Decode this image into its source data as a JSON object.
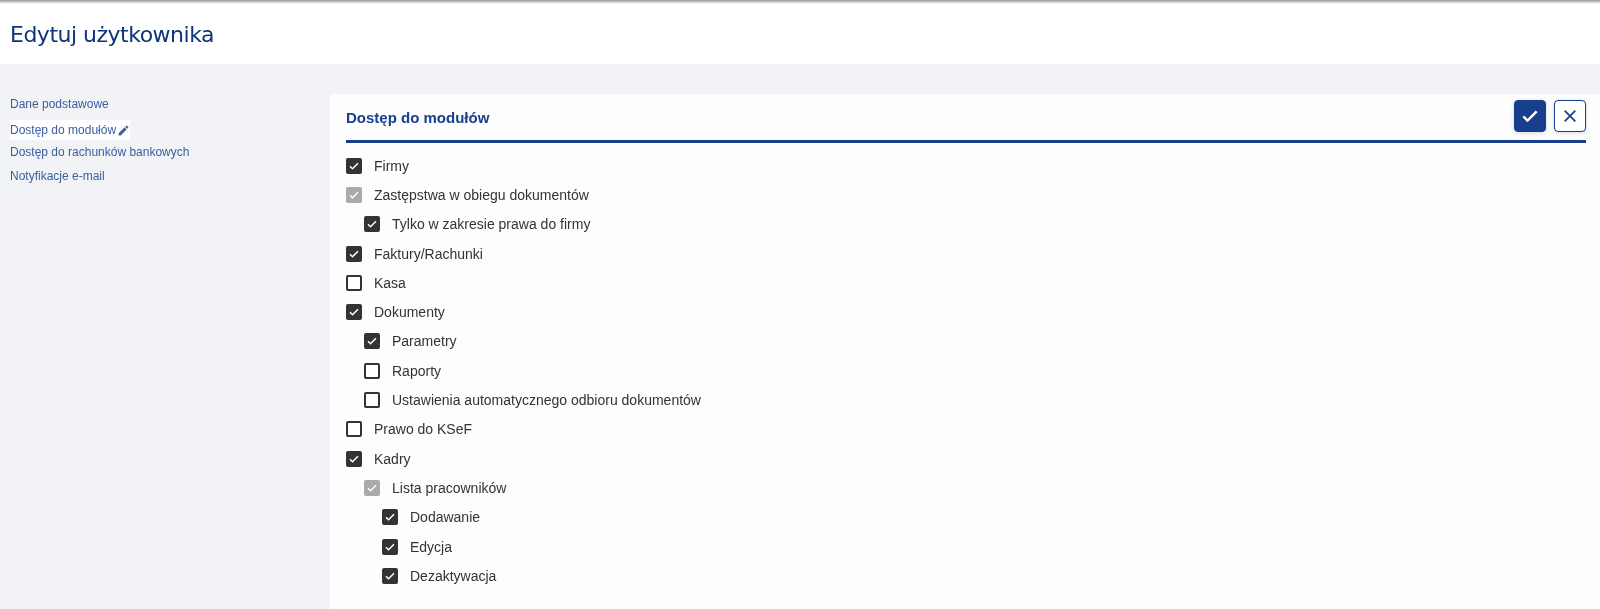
{
  "page_title": "Edytuj użytkownika",
  "sidebar": {
    "items": [
      {
        "label": "Dane podstawowe",
        "selected": false,
        "editing": false
      },
      {
        "label": "Dostęp do modułów",
        "selected": true,
        "editing": true
      },
      {
        "label": "Dostęp do rachunków bankowych",
        "selected": false,
        "editing": false
      },
      {
        "label": "Notyfikacje e-mail",
        "selected": false,
        "editing": false
      }
    ]
  },
  "panel": {
    "title": "Dostęp do modułów",
    "actions": [
      {
        "kind": "confirm"
      },
      {
        "kind": "cancel"
      }
    ],
    "modules": [
      {
        "label": "Firmy",
        "checked": true,
        "disabled": false
      },
      {
        "label": "Zastępstwa w obiegu dokumentów",
        "checked": true,
        "disabled": true,
        "children": [
          {
            "label": "Tylko w zakresie prawa do firmy",
            "checked": true,
            "disabled": false
          }
        ]
      },
      {
        "label": "Faktury/Rachunki",
        "checked": true,
        "disabled": false
      },
      {
        "label": "Kasa",
        "checked": false,
        "disabled": false
      },
      {
        "label": "Dokumenty",
        "checked": true,
        "disabled": false,
        "children": [
          {
            "label": "Parametry",
            "checked": true,
            "disabled": false
          },
          {
            "label": "Raporty",
            "checked": false,
            "disabled": false
          },
          {
            "label": "Ustawienia automatycznego odbioru dokumentów",
            "checked": false,
            "disabled": false
          }
        ]
      },
      {
        "label": "Prawo do KSeF",
        "checked": false,
        "disabled": false
      },
      {
        "label": "Kadry",
        "checked": true,
        "disabled": false,
        "children": [
          {
            "label": "Lista pracowników",
            "checked": true,
            "disabled": true,
            "children": [
              {
                "label": "Dodawanie",
                "checked": true,
                "disabled": false
              },
              {
                "label": "Edycja",
                "checked": true,
                "disabled": false
              },
              {
                "label": "Dezaktywacja",
                "checked": true,
                "disabled": false
              }
            ]
          }
        ]
      }
    ]
  }
}
